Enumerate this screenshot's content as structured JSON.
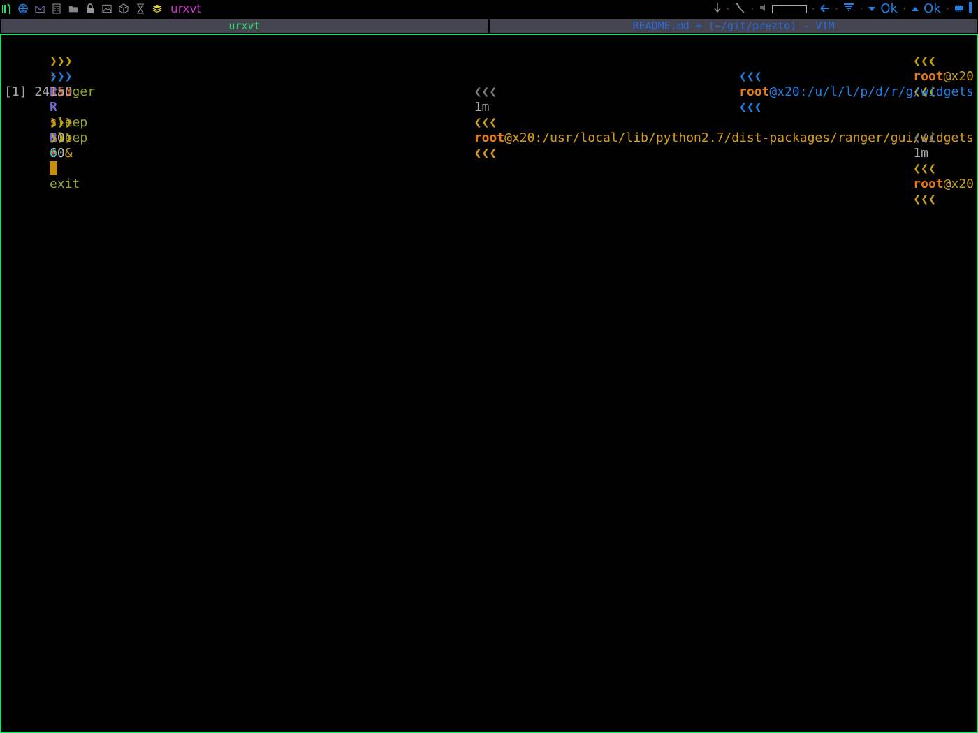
{
  "topbar": {
    "icons": [
      "tools-icon",
      "globe-icon",
      "mail-icon",
      "calculator-icon",
      "folder-icon",
      "lock-icon",
      "image-icon",
      "cube-icon",
      "hourglass-icon",
      "layers-icon"
    ],
    "window_title": "urxvt",
    "status_ok_1": "Ok",
    "status_ok_2": "Ok",
    "dots": "·"
  },
  "tabs": [
    {
      "label": "urxvt",
      "active": true
    },
    {
      "label": "README.md + (~/git/prezto) - VIM",
      "active": false
    }
  ],
  "terminal": {
    "line1": {
      "prompt": "❯❯❯",
      "bolt": "⚡",
      "cmd": "ranger",
      "rprompt_arrows": "❮❮❮",
      "user": "root",
      "host": "@x20",
      "rend": "❮❮❮"
    },
    "line2": {
      "prompt": "❯❯❯",
      "ranger_mark": "R",
      "bolt": "⚡",
      "cmd": "sleep",
      "arg": "60",
      "arrows": "❮❮❮",
      "user": "root",
      "path": "@x20:/u/l/l/p/d/r/g/widgets",
      "rend": "❮❮❮"
    },
    "line3": {
      "prompt": "❯❯❯",
      "ranger_mark": "R",
      "bolt": "⚡",
      "cmd": "sleep",
      "arg": "60",
      "amp": "&",
      "duration_arrows": "❮❮❮",
      "duration": "1m",
      "arrows": "❮❮❮",
      "user": "root",
      "path": "@x20:/usr/local/lib/python2.7/dist-packages/ranger/gui/widgets",
      "rend": "❮❮❮"
    },
    "line4": {
      "job": "[1] 24150"
    },
    "line5": {
      "prompt": "❯❯❯",
      "ranger_mark": "R",
      "gear": "⚙",
      "bolt": "⚡",
      "cmd": "exit",
      "arrows": "❮❮❮",
      "user": "root",
      "path": "@x20:/usr/local/lib/python2.7/dist-packages/ranger/gui/widgets",
      "rend": "❮❮❮"
    },
    "line6": {
      "prompt": "❯❯❯",
      "bolt": "⚡",
      "duration_arrows": "❮❮❮",
      "duration": "1m",
      "arrows": "❮❮❮",
      "user": "root",
      "host": "@x20",
      "rend": "❮❮❮"
    }
  }
}
